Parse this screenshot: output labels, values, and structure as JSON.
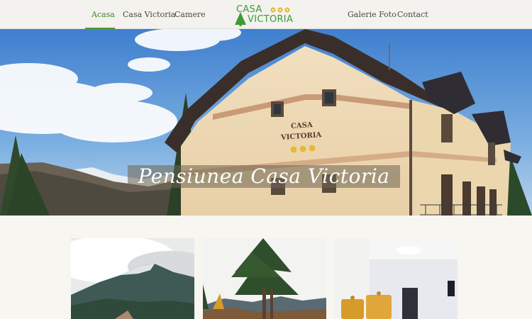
{
  "nav": {
    "left_items": [
      {
        "label": "Acasa",
        "active": true
      },
      {
        "label": "Casa Victoria",
        "active": false
      },
      {
        "label": "Camere",
        "active": false
      }
    ],
    "right_items": [
      {
        "label": "Galerie Foto",
        "active": false
      },
      {
        "label": "Contact",
        "active": false
      }
    ],
    "logo": {
      "line1": "CASA",
      "line2": "VICTORIA",
      "icon": "pine-tree-icon",
      "flowers_icon": "daisy-flowers-icon"
    }
  },
  "hero": {
    "title": "Pensiunea Casa Victoria",
    "building_sign": {
      "line1": "CASA",
      "line2": "VICTORIA"
    }
  },
  "gallery": {
    "cards": [
      {
        "subject": "mountain-peak-photo"
      },
      {
        "subject": "pine-trees-photo"
      },
      {
        "subject": "room-interior-photo"
      }
    ]
  },
  "colors": {
    "accent_green": "#4f9a2e",
    "logo_green": "#3f9a36",
    "nav_text": "#4a4a3a",
    "nav_bg": "#f3f2ee",
    "page_bg": "#f8f6f0"
  }
}
